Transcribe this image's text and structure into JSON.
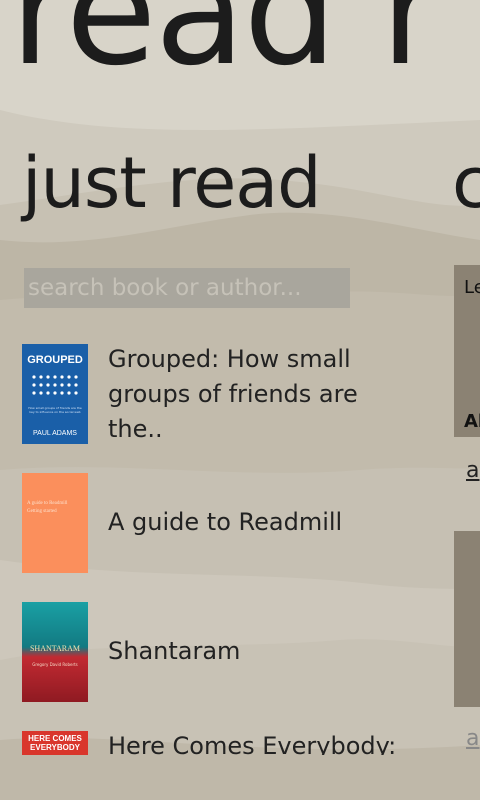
{
  "app": {
    "title": "read r"
  },
  "section": {
    "title": "just read",
    "next_title": "c"
  },
  "search": {
    "placeholder": "search book or author..."
  },
  "books": [
    {
      "title": "Grouped: How small groups of friends are the..",
      "cover_text": "GROUPED",
      "cover_author": "PAUL ADAMS",
      "cover_blurb": "How small groups of friends are the key to influence on the social web",
      "cover_color": "#1a5fa8"
    },
    {
      "title": "A guide to Readmill",
      "cover_text": "A guide to Readmill",
      "cover_sub": "Getting started",
      "cover_color": "#fb8f5c"
    },
    {
      "title": "Shantaram",
      "cover_text": "SHANTARAM",
      "cover_author": "Gregory David Roberts",
      "cover_color": "#1a8e96"
    },
    {
      "title": "Here Comes Everybody:",
      "cover_text": "HERE COMES EVERYBODY",
      "cover_color": "#d9362c"
    }
  ],
  "right_panel": {
    "card1_top": "Le",
    "card1_bottom": "Al",
    "link1": "a",
    "link2": "a"
  }
}
